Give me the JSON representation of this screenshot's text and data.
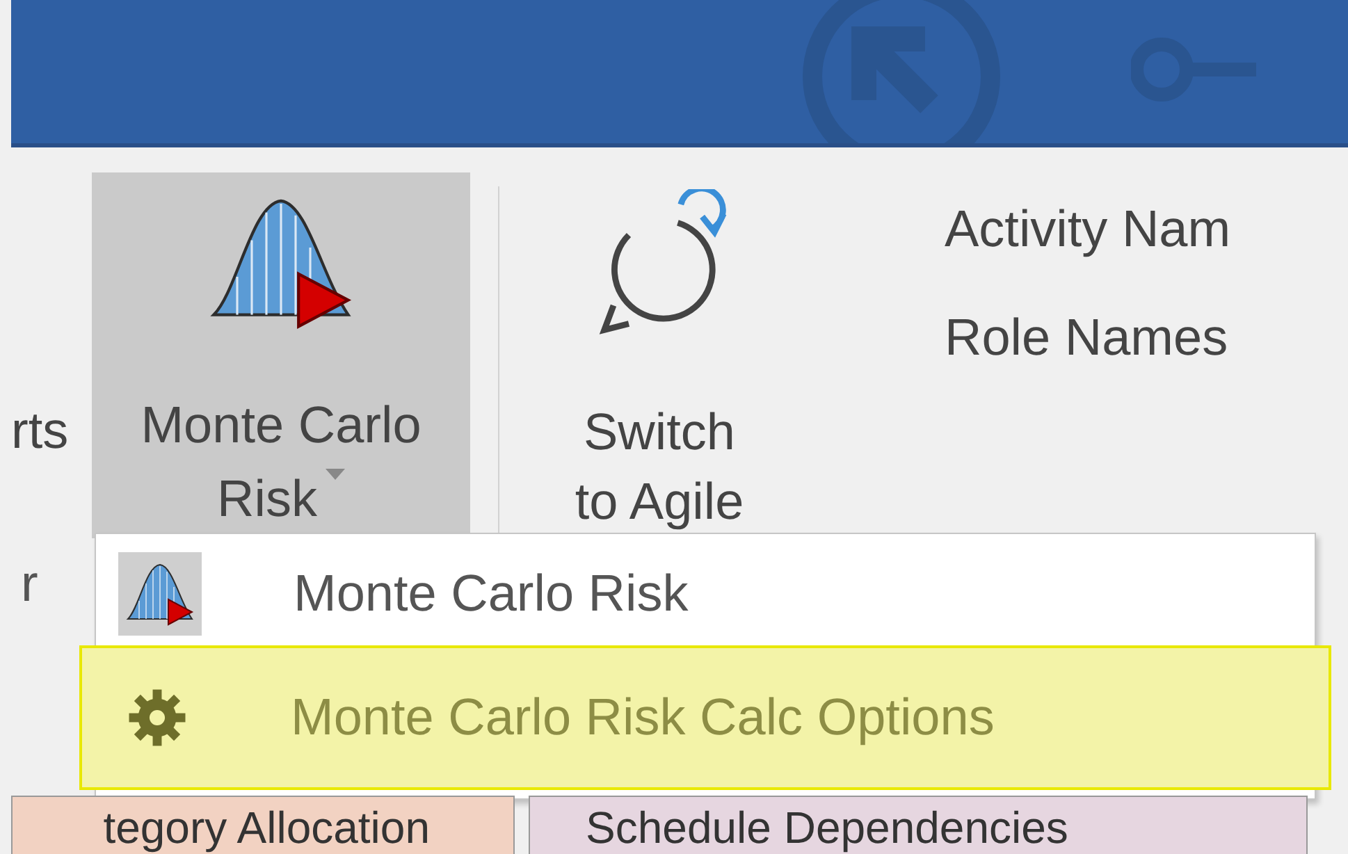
{
  "ribbon": {
    "left_fragment": "rts",
    "buttons": [
      {
        "kind": "dropdown",
        "lines": [
          "Monte Carlo",
          "Risk"
        ],
        "selected": true
      },
      {
        "kind": "large",
        "lines": [
          "Switch",
          "to Agile"
        ],
        "selected": false
      }
    ],
    "commands": [
      "Activity Nam",
      "Role Names"
    ],
    "group_label": "r"
  },
  "dropdown": {
    "items": [
      {
        "label": "Monte Carlo Risk",
        "selected": false
      },
      {
        "label": "Monte Carlo Risk Calc Options",
        "selected": true
      }
    ]
  },
  "tabs": [
    {
      "label": "tegory Allocation",
      "color": "#f2d2c2"
    },
    {
      "label": "Schedule Dependencies",
      "color": "#e6d6e0"
    }
  ]
}
